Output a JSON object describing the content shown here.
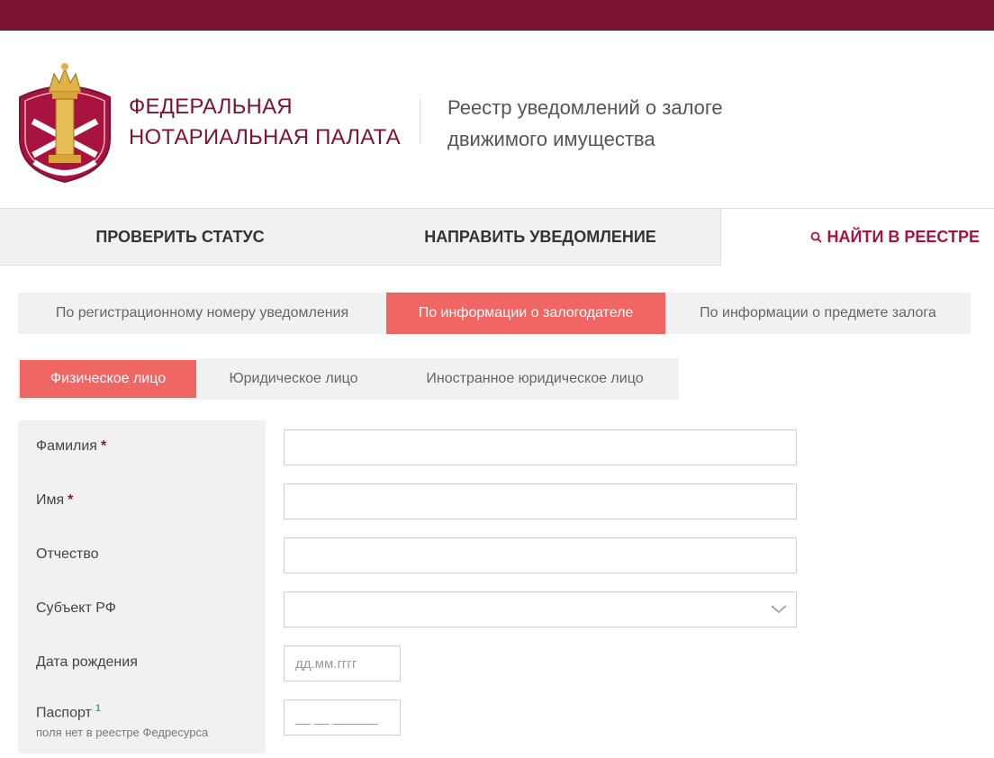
{
  "colors": {
    "brand": "#7a1432",
    "accent": "#ef6664",
    "link": "#a8123e"
  },
  "header": {
    "logo_icon": "notary-crest-icon",
    "org_name_line1": "ФЕДЕРАЛЬНАЯ",
    "org_name_line2": "НОТАРИАЛЬНАЯ ПАЛАТА",
    "registry_line1": "Реестр уведомлений о залоге",
    "registry_line2": "движимого имущества"
  },
  "main_nav": {
    "tabs": [
      {
        "label": "ПРОВЕРИТЬ СТАТУС",
        "active": false
      },
      {
        "label": "НАПРАВИТЬ УВЕДОМЛЕНИЕ",
        "active": false
      },
      {
        "label": "НАЙТИ В РЕЕСТРЕ",
        "active": true,
        "icon": "search-icon"
      }
    ]
  },
  "search_mode": {
    "options": [
      {
        "label": "По регистрационному номеру уведомления",
        "active": false
      },
      {
        "label": "По информации о залогодателе",
        "active": true
      },
      {
        "label": "По информации о предмете залога",
        "active": false
      }
    ]
  },
  "person_type": {
    "options": [
      {
        "label": "Физическое лицо",
        "active": true
      },
      {
        "label": "Юридическое лицо",
        "active": false
      },
      {
        "label": "Иностранное юридическое лицо",
        "active": false
      }
    ]
  },
  "form": {
    "fields": [
      {
        "label": "Фамилия",
        "required_mark": "*",
        "value": "",
        "placeholder": ""
      },
      {
        "label": "Имя",
        "required_mark": "*",
        "value": "",
        "placeholder": ""
      },
      {
        "label": "Отчество",
        "value": "",
        "placeholder": ""
      },
      {
        "label": "Субъект РФ",
        "value": "",
        "selected": "",
        "icon": "chevron-down-icon"
      },
      {
        "label": "Дата рождения",
        "value": "",
        "placeholder": "дд.мм.гггг"
      },
      {
        "label": "Паспорт",
        "footnote": "1",
        "note": "поля нет в реестре Федресурса",
        "value": "",
        "placeholder": "__ __ ______"
      }
    ]
  }
}
